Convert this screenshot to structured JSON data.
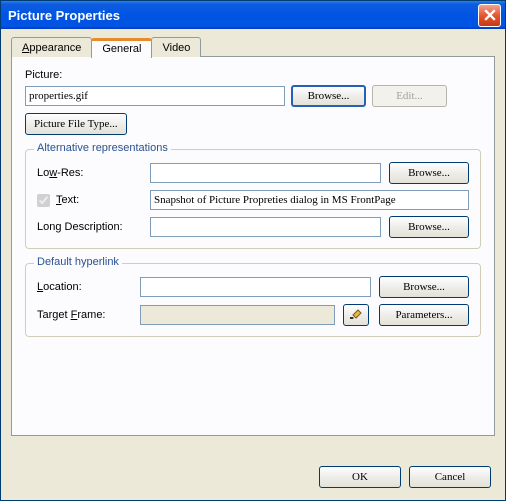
{
  "title": "Picture Properties",
  "tabs": {
    "appearance": "Appearance",
    "general": "General",
    "video": "Video"
  },
  "picture": {
    "label": "Picture:",
    "value": "properties.gif",
    "browse": "Browse...",
    "edit": "Edit...",
    "filetype": "Picture File Type..."
  },
  "alt": {
    "legend": "Alternative representations",
    "lowres": "Low-Res:",
    "lowres_val": "",
    "text": "Text:",
    "text_val": "Snapshot of Picture Propreties dialog in MS FrontPage",
    "longdesc": "Long Description:",
    "longdesc_val": "",
    "browse": "Browse..."
  },
  "link": {
    "legend": "Default hyperlink",
    "location": "Location:",
    "location_val": "",
    "target": "Target Frame:",
    "target_val": "",
    "browse": "Browse...",
    "params": "Parameters..."
  },
  "buttons": {
    "ok": "OK",
    "cancel": "Cancel"
  }
}
